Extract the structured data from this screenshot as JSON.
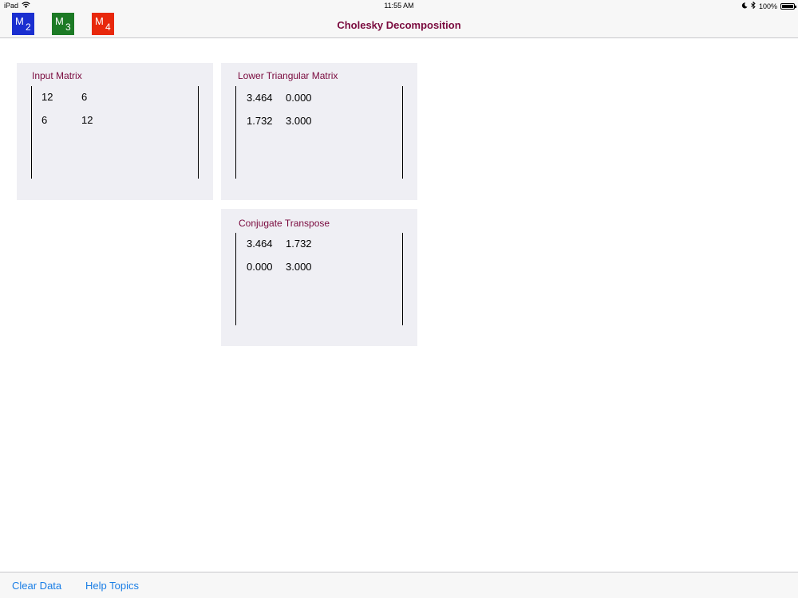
{
  "status_bar": {
    "device": "iPad",
    "time": "11:55 AM",
    "battery": "100%"
  },
  "nav": {
    "title": "Cholesky Decomposition",
    "buttons": [
      {
        "letter": "M",
        "sub": "2",
        "color": "#1a2fd0"
      },
      {
        "letter": "M",
        "sub": "3",
        "color": "#1c7a25"
      },
      {
        "letter": "M",
        "sub": "4",
        "color": "#e8280c"
      }
    ]
  },
  "input_matrix": {
    "title": "Input Matrix",
    "rows": [
      [
        "12",
        "6"
      ],
      [
        "6",
        "12"
      ]
    ]
  },
  "lower_matrix": {
    "title": "Lower Triangular Matrix",
    "rows": [
      [
        "3.464",
        "0.000"
      ],
      [
        "1.732",
        "3.000"
      ]
    ]
  },
  "conjugate_transpose": {
    "title": "Conjugate Transpose",
    "rows": [
      [
        "3.464",
        "1.732"
      ],
      [
        "0.000",
        "3.000"
      ]
    ]
  },
  "toolbar": {
    "clear_label": "Clear Data",
    "help_label": "Help Topics"
  },
  "colors": {
    "title_accent": "#7a0a3e",
    "link_blue": "#1a7ee6",
    "panel_bg": "#efeff4"
  }
}
